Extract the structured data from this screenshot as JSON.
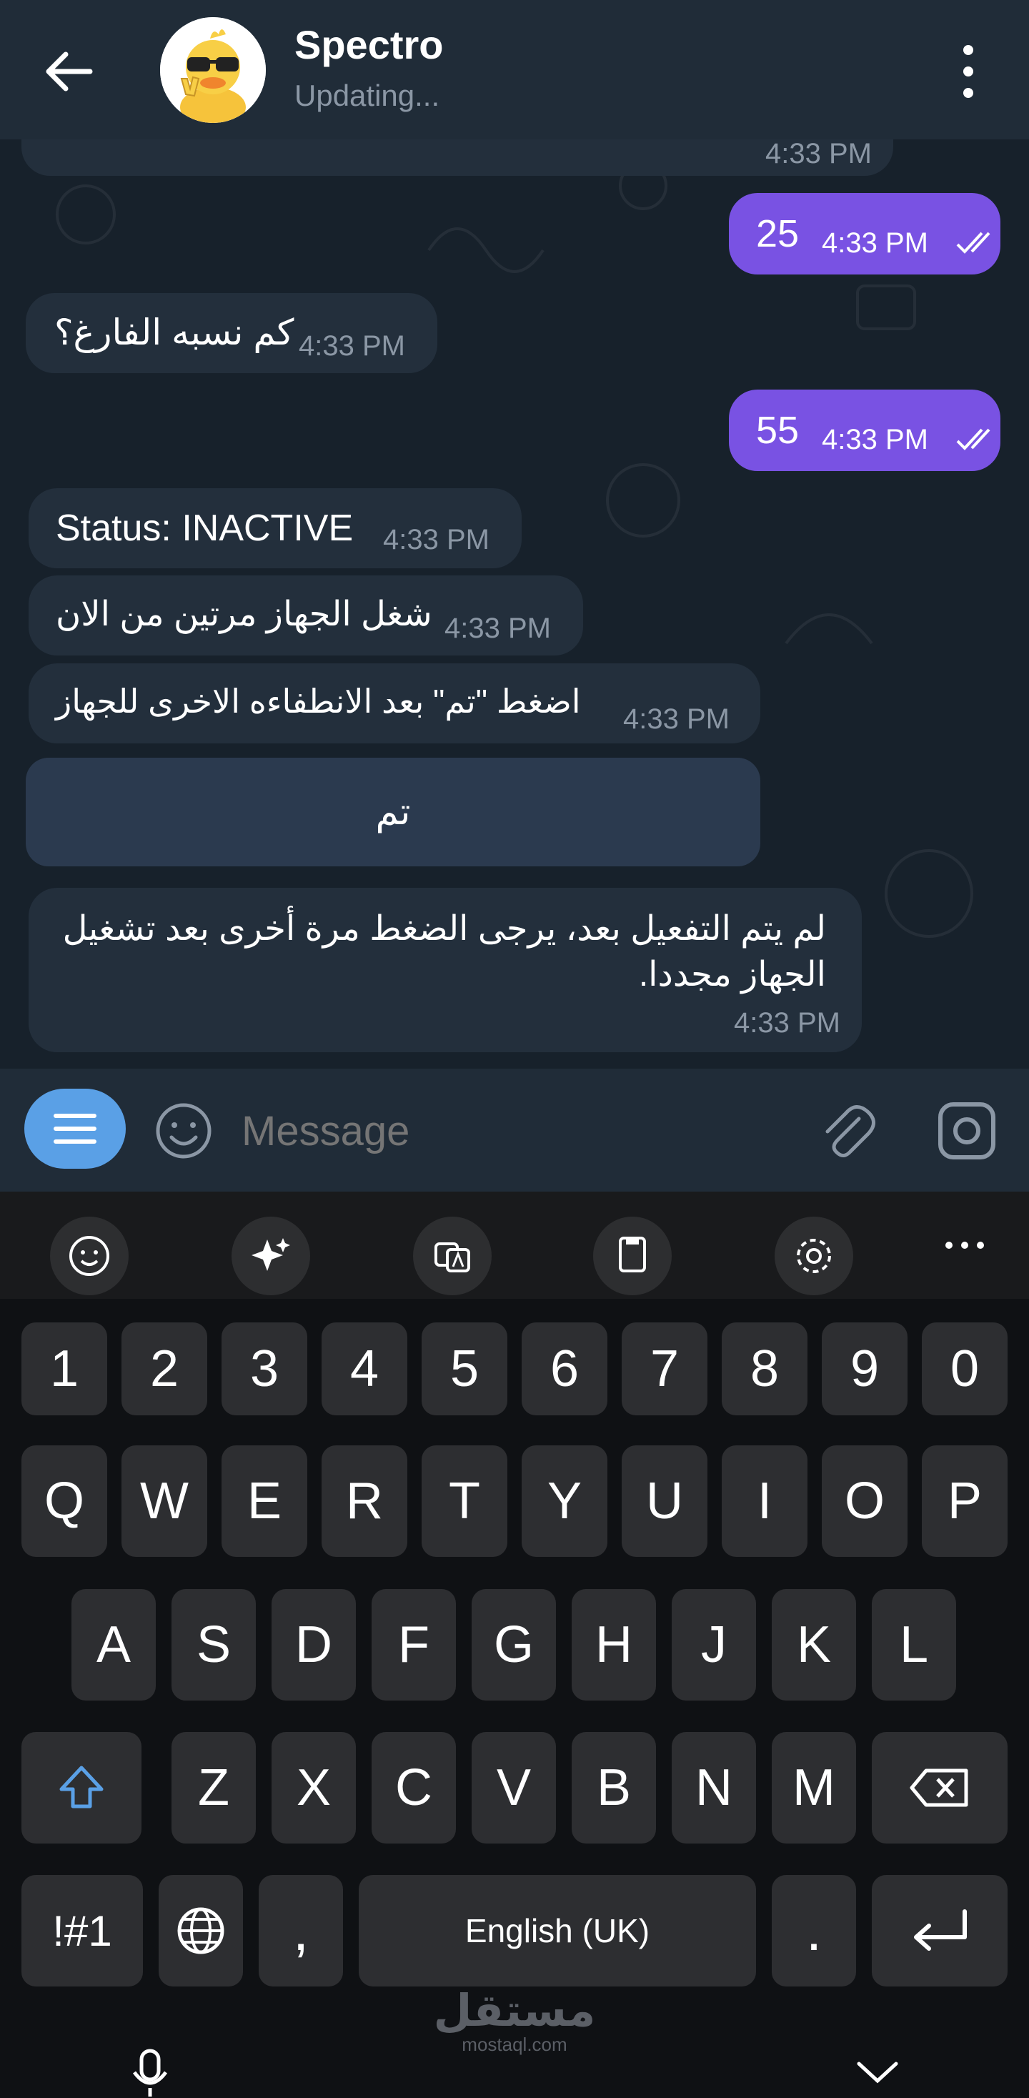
{
  "header": {
    "title": "Spectro",
    "status": "Updating..."
  },
  "messages": [
    {
      "side": "in",
      "text": "",
      "time": "4:33 PM"
    },
    {
      "side": "out",
      "text": "25",
      "time": "4:33 PM"
    },
    {
      "side": "in",
      "text": "كم نسبه الفارغ؟",
      "time": "4:33 PM"
    },
    {
      "side": "out",
      "text": "55",
      "time": "4:33 PM"
    },
    {
      "side": "in",
      "text": "Status: INACTIVE",
      "time": "4:33 PM"
    },
    {
      "side": "in",
      "text": "شغل الجهاز مرتين من الان",
      "time": "4:33 PM"
    },
    {
      "side": "in",
      "text": "اضغط \"تم\" بعد الانطفاءه الاخرى للجهاز",
      "time": "4:33 PM"
    },
    {
      "side": "in",
      "text": "لم يتم التفعيل بعد، يرجى الضغط مرة أخرى بعد تشغيل الجهاز مجددا.",
      "time": "4:33 PM"
    }
  ],
  "inline_button": "تم",
  "composer": {
    "placeholder": "Message"
  },
  "keyboard": {
    "row1": [
      "1",
      "2",
      "3",
      "4",
      "5",
      "6",
      "7",
      "8",
      "9",
      "0"
    ],
    "row2": [
      "Q",
      "W",
      "E",
      "R",
      "T",
      "Y",
      "U",
      "I",
      "O",
      "P"
    ],
    "row3": [
      "A",
      "S",
      "D",
      "F",
      "G",
      "H",
      "J",
      "K",
      "L"
    ],
    "row4": [
      "Z",
      "X",
      "C",
      "V",
      "B",
      "N",
      "M"
    ],
    "sym": "!#1",
    "comma": ",",
    "space": "English (UK)",
    "period": "."
  },
  "watermark": {
    "arabic": "مستقل",
    "latin": "mostaql.com"
  },
  "colors": {
    "chat_bg": "#17212b",
    "header_bg": "#202c38",
    "incoming_bubble": "#232f3c",
    "outgoing_bubble": "#7952e3",
    "accent": "#5aa0e6"
  }
}
